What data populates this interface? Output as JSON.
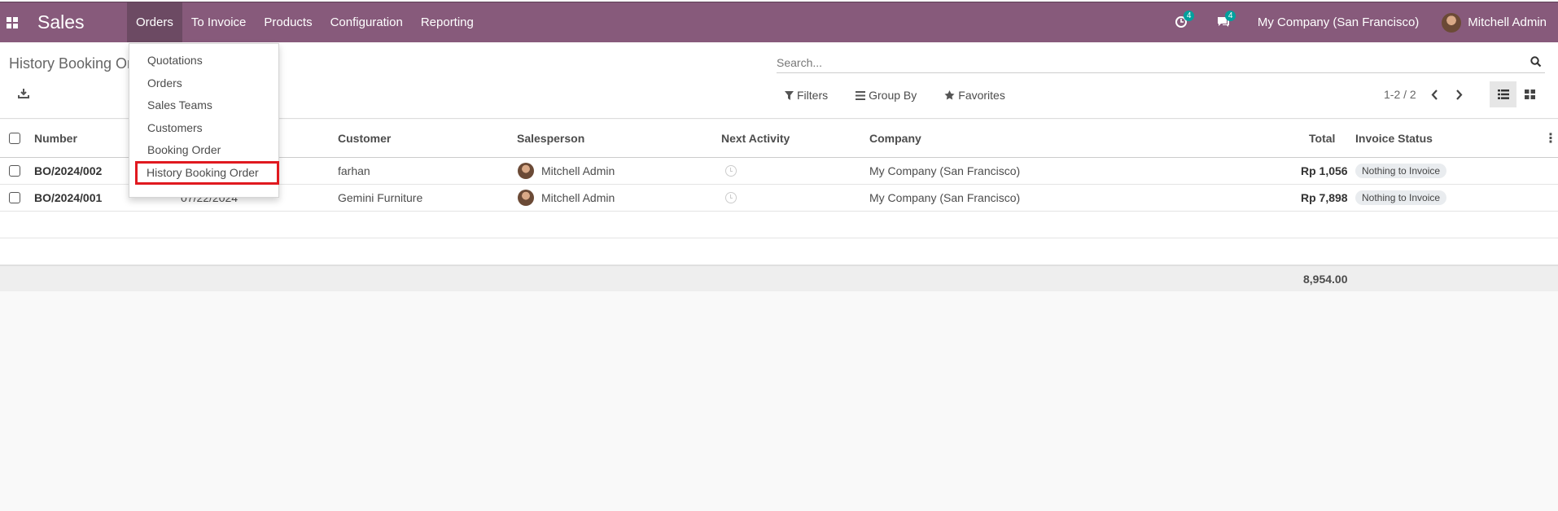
{
  "navbar": {
    "brand": "Sales",
    "menu": [
      "Orders",
      "To Invoice",
      "Products",
      "Configuration",
      "Reporting"
    ],
    "activity_count": "4",
    "message_count": "4",
    "company": "My Company (San Francisco)",
    "user": "Mitchell Admin",
    "color": "#875a7b"
  },
  "control_panel": {
    "breadcrumb": "History Booking Order",
    "search_placeholder": "Search...",
    "filters_label": "Filters",
    "group_by_label": "Group By",
    "favorites_label": "Favorites",
    "pager": "1-2 / 2"
  },
  "table": {
    "headers": {
      "number": "Number",
      "customer": "Customer",
      "salesperson": "Salesperson",
      "next_activity": "Next Activity",
      "company": "Company",
      "total": "Total",
      "invoice_status": "Invoice Status"
    },
    "rows": [
      {
        "number": "BO/2024/002",
        "date": "",
        "customer": "farhan",
        "salesperson": "Mitchell Admin",
        "company": "My Company (San Francisco)",
        "total": "Rp 1,056",
        "invoice_status": "Nothing to Invoice"
      },
      {
        "number": "BO/2024/001",
        "date": "07/22/2024",
        "customer": "Gemini Furniture",
        "salesperson": "Mitchell Admin",
        "company": "My Company (San Francisco)",
        "total": "Rp 7,898",
        "invoice_status": "Nothing to Invoice"
      }
    ],
    "footer_total": "8,954.00"
  },
  "dropdown": {
    "items": [
      "Quotations",
      "Orders",
      "Sales Teams",
      "Customers",
      "Booking Order",
      "History Booking Order"
    ],
    "highlight_color": "#e0191f"
  }
}
